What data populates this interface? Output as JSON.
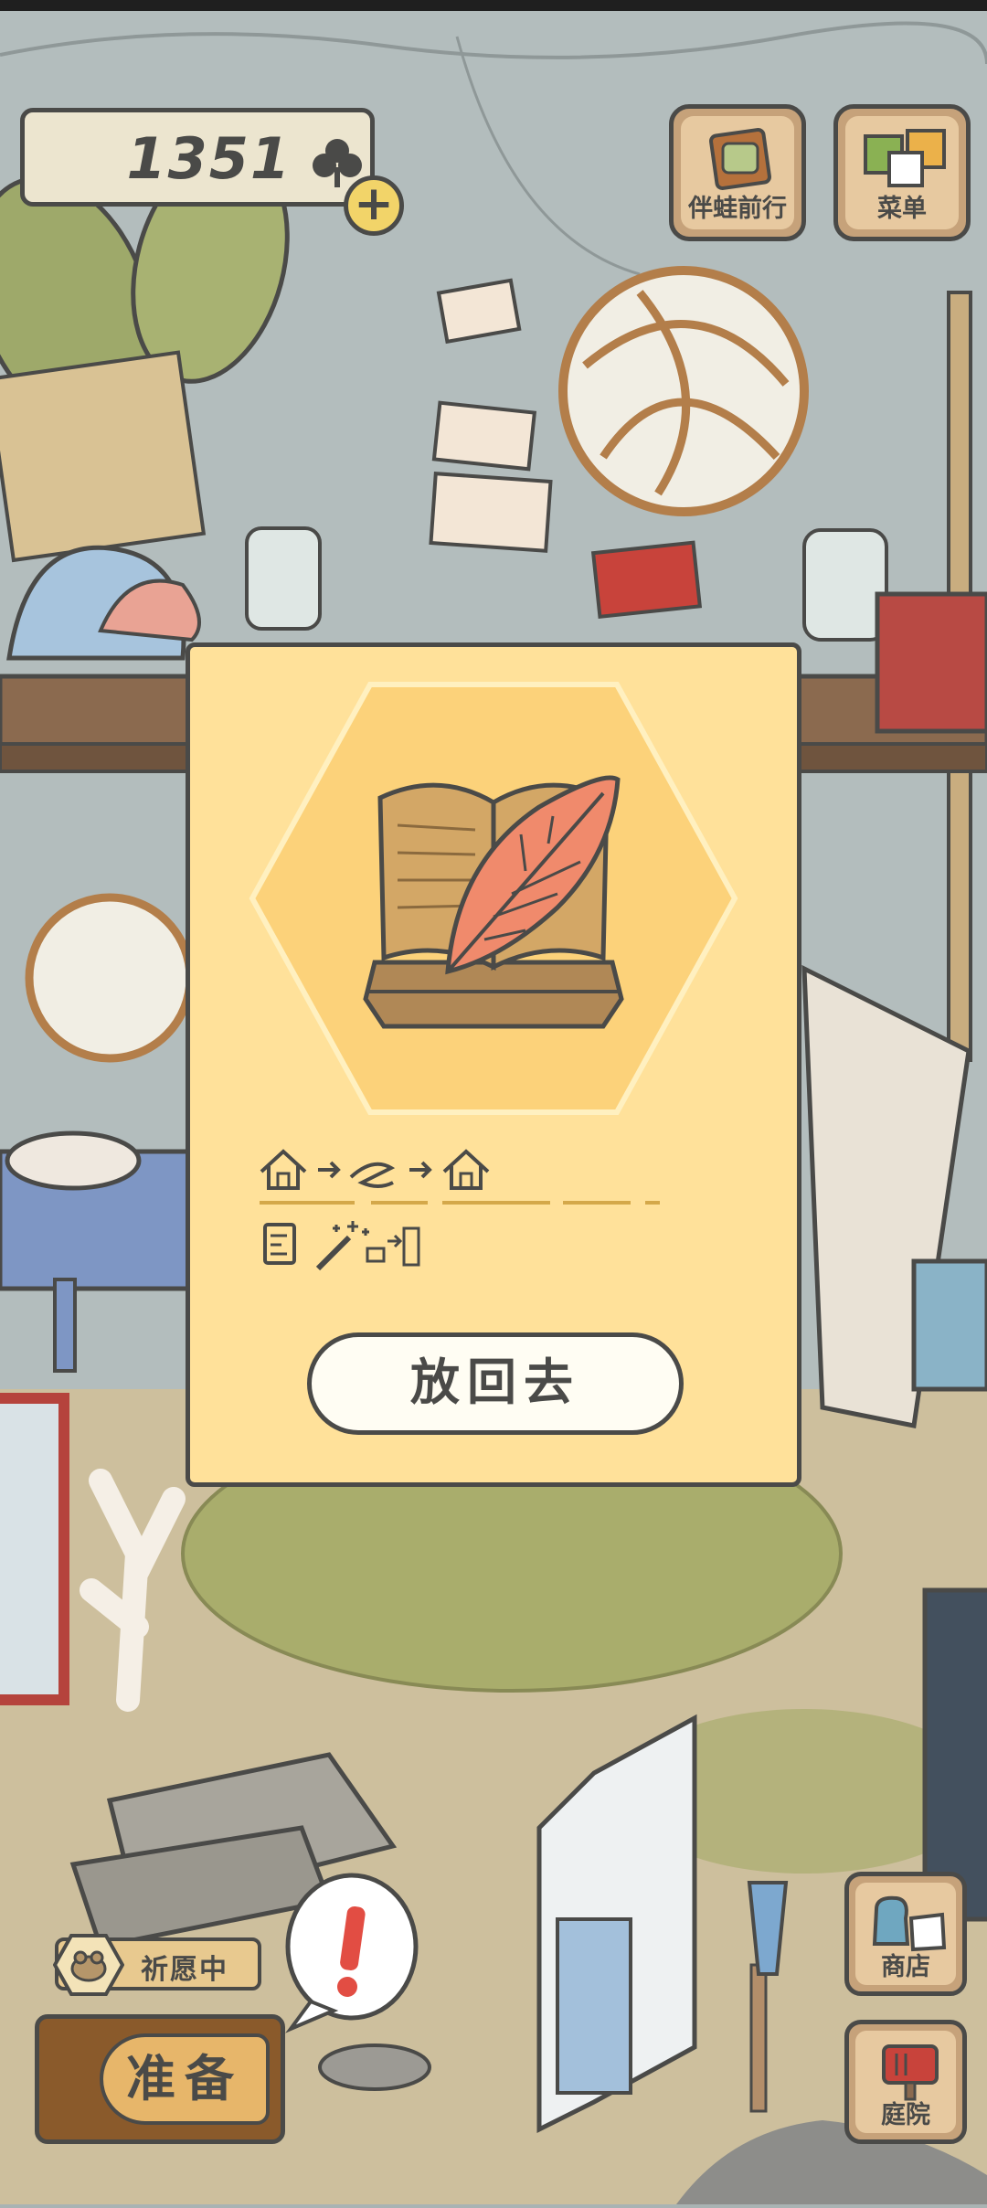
{
  "currency": {
    "clover_count": "1351",
    "add_symbol": "+"
  },
  "top_menu": {
    "travel_companion_label": "伴蛙前行",
    "menu_label": "菜单"
  },
  "item_dialog": {
    "item_icon": "book-with-leaf-icon",
    "put_back_label": "放回去"
  },
  "bottom_left": {
    "wish_label": "祈愿中",
    "prepare_label": "准备"
  },
  "bottom_right": {
    "shop_label": "商店",
    "yard_label": "庭院"
  },
  "colors": {
    "dialog_bg": "#ffe19a",
    "hex_bg": "#fcd27a",
    "outline": "#4a4a48",
    "wood": "#c6a27a"
  }
}
